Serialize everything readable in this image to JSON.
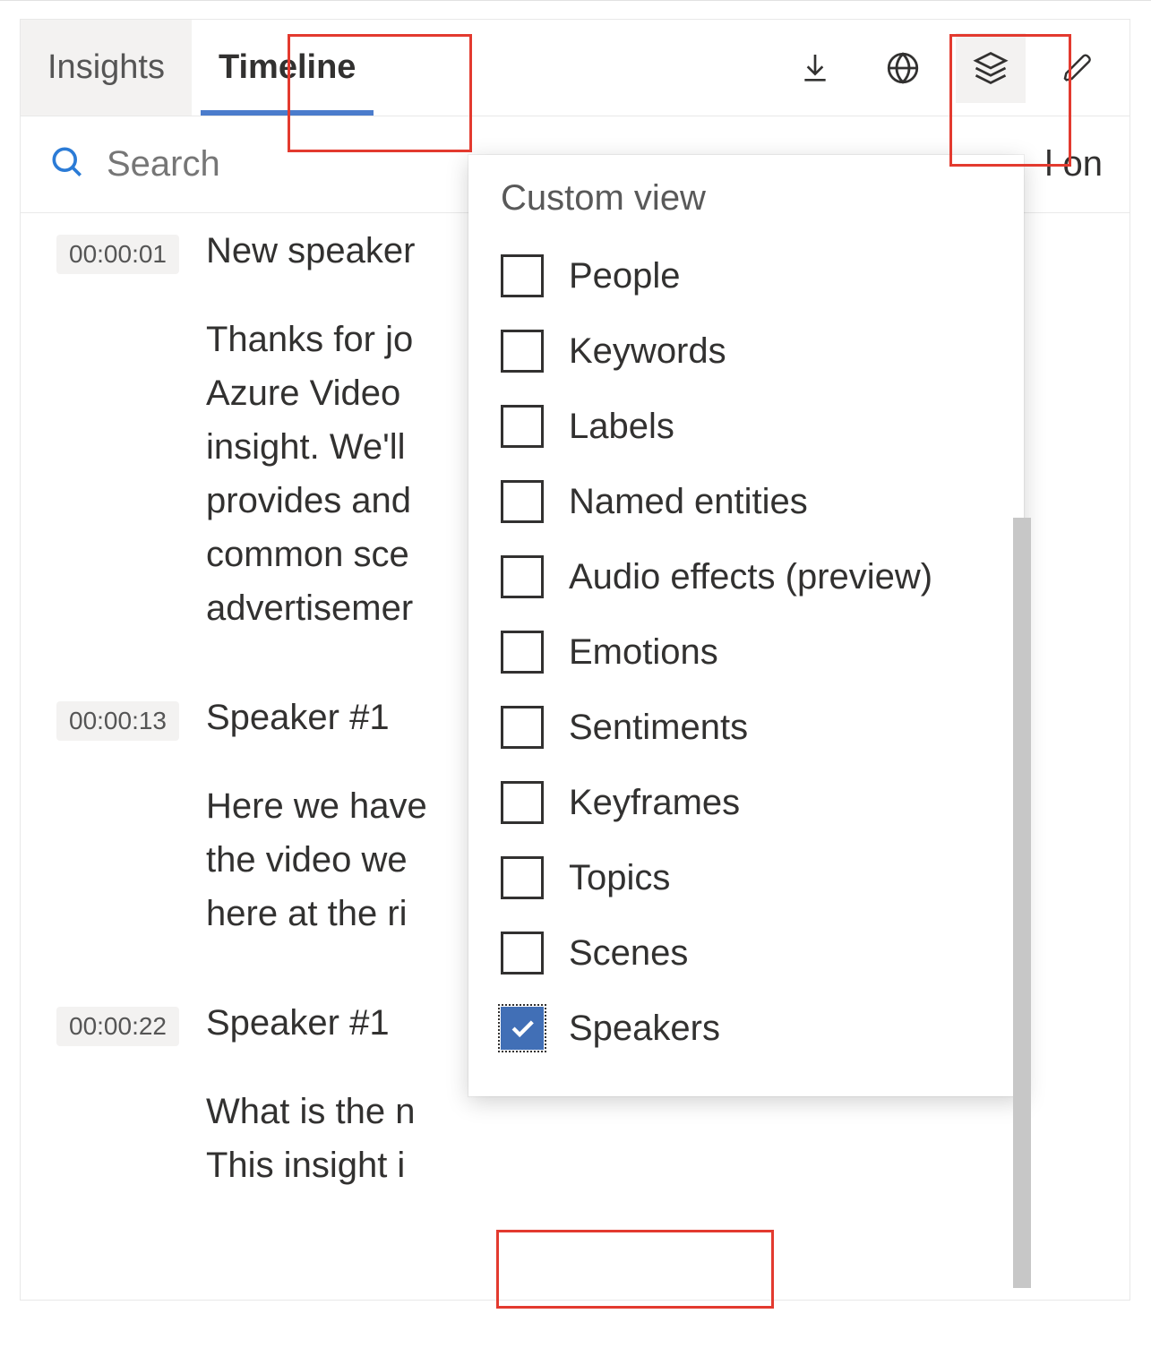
{
  "tabs": {
    "insights": "Insights",
    "timeline": "Timeline"
  },
  "search": {
    "placeholder": "Search",
    "autoscroll_label": "l on"
  },
  "entries": [
    {
      "time": "00:00:01",
      "speaker": "New speaker",
      "text": "Thanks for jo\nAzure Video\ninsight. We'll\nprovides and\ncommon sce\nadvertisemer"
    },
    {
      "time": "00:00:13",
      "speaker": "Speaker #1",
      "text": "Here we have\nthe video we\nhere at the ri"
    },
    {
      "time": "00:00:22",
      "speaker": "Speaker #1",
      "text": "What is the n\nThis insight i"
    }
  ],
  "dropdown": {
    "title": "Custom view",
    "items": [
      {
        "label": "People",
        "checked": false
      },
      {
        "label": "Keywords",
        "checked": false
      },
      {
        "label": "Labels",
        "checked": false
      },
      {
        "label": "Named entities",
        "checked": false
      },
      {
        "label": "Audio effects (preview)",
        "checked": false
      },
      {
        "label": "Emotions",
        "checked": false
      },
      {
        "label": "Sentiments",
        "checked": false
      },
      {
        "label": "Keyframes",
        "checked": false
      },
      {
        "label": "Topics",
        "checked": false
      },
      {
        "label": "Scenes",
        "checked": false
      },
      {
        "label": "Speakers",
        "checked": true
      }
    ]
  },
  "icons": {
    "download": "download-icon",
    "globe": "globe-icon",
    "layers": "layers-icon",
    "edit": "edit-icon",
    "search": "search-icon"
  }
}
